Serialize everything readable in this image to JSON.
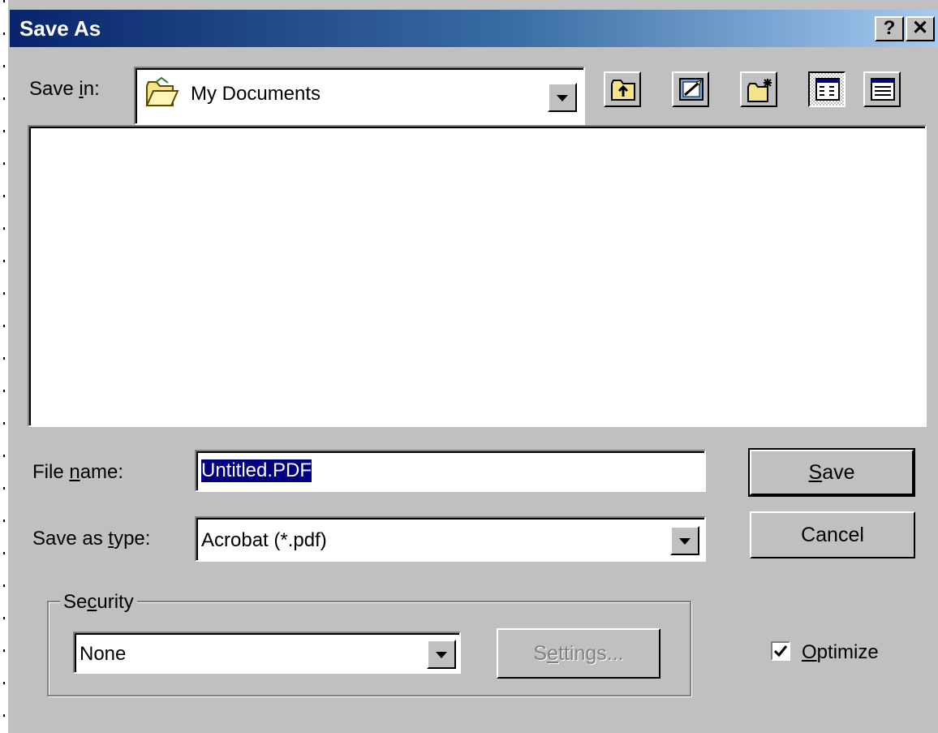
{
  "window": {
    "title": "Save As",
    "help_label": "?",
    "close_label": "✕"
  },
  "save_in": {
    "label_pre": "Save ",
    "label_key": "i",
    "label_post": "n:",
    "value": "My Documents",
    "folder_icon": "open-folder-icon"
  },
  "toolbar": {
    "icons": [
      "up-one-level-icon",
      "desktop-icon",
      "new-folder-icon",
      "list-view-icon",
      "details-view-icon"
    ]
  },
  "file_list": {
    "items": []
  },
  "file_name": {
    "label_pre": "File ",
    "label_key": "n",
    "label_post": "ame:",
    "value": "Untitled.PDF"
  },
  "save_type": {
    "label_pre": "Save as ",
    "label_key": "t",
    "label_post": "ype:",
    "value": "Acrobat (*.pdf)"
  },
  "buttons": {
    "save_key": "S",
    "save_rest": "ave",
    "cancel": "Cancel"
  },
  "security": {
    "legend_pre": "Se",
    "legend_key": "c",
    "legend_post": "urity",
    "value": "None",
    "settings_pre": "S",
    "settings_key": "e",
    "settings_post": "ttings..."
  },
  "optimize": {
    "checked": true,
    "label_key": "O",
    "label_rest": "ptimize"
  },
  "colors": {
    "title_start": "#08246b",
    "title_end": "#a6caf0",
    "face": "#c0c0c0",
    "selection": "#000080"
  }
}
